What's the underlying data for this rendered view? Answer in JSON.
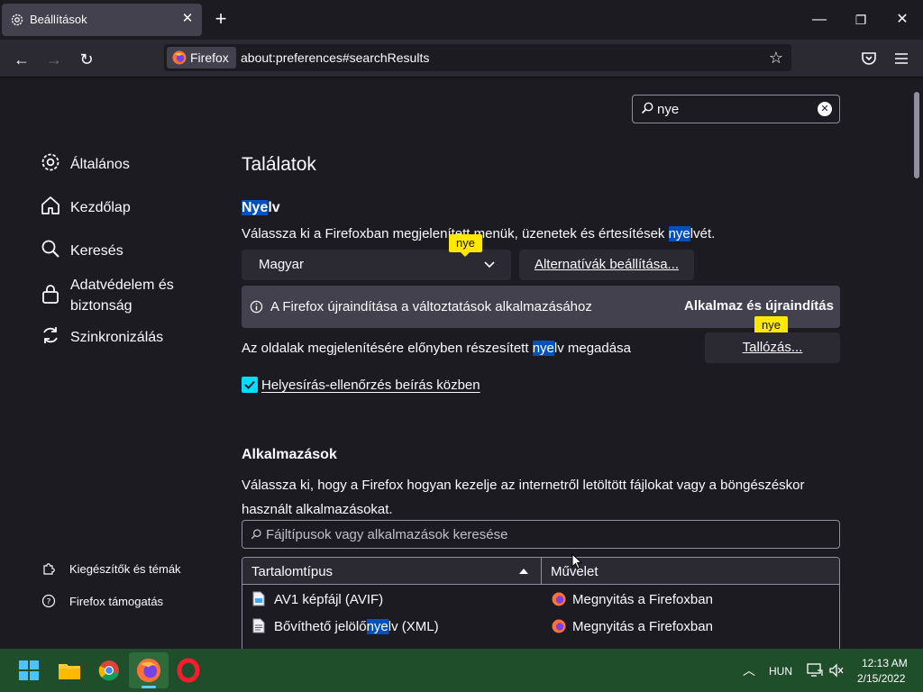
{
  "browser": {
    "tab_title": "Beállítások",
    "identity_label": "Firefox",
    "url": "about:preferences#searchResults"
  },
  "search": {
    "value": "nye"
  },
  "sidebar": {
    "categories": [
      {
        "label": "Általános"
      },
      {
        "label": "Kezdőlap"
      },
      {
        "label": "Keresés"
      },
      {
        "label": "Adatvédelem és biztonság"
      },
      {
        "label": "Szinkronizálás"
      }
    ],
    "footer": [
      {
        "label": "Kiegészítők és témák"
      },
      {
        "label": "Firefox támogatás"
      }
    ]
  },
  "main": {
    "results_title": "Találatok",
    "language": {
      "heading_hl": "Nye",
      "heading_rest": "lv",
      "desc_before": "Válassza ki a Firefoxban megjelenített menük, üzenetek és értesítések ",
      "desc_hl": "nye",
      "desc_after": "lvét.",
      "select_value": "Magyar",
      "alt_button": "Alternatívák beállítása...",
      "restart_notice": "A Firefox újraindítása a változtatások alkalmazásához",
      "restart_button": "Alkalmaz és újraindítás",
      "pref_before": "Az oldalak megjelenítésére előnyben részesített ",
      "pref_hl": "nye",
      "pref_after": "lv megadása",
      "browse_button": "Tallózás...",
      "spellcheck_label": "Helyesírás-ellenőrzés beírás közben",
      "spellcheck_checked": true
    },
    "badges": [
      "nye",
      "nye"
    ],
    "apps": {
      "heading": "Alkalmazások",
      "desc_line1": "Válassza ki, hogy a Firefox hogyan kezelje az internetről letöltött fájlokat vagy a böngészéskor",
      "desc_line2": "használt alkalmazásokat.",
      "filter_placeholder": "Fájltípusok vagy alkalmazások keresése",
      "col_type": "Tartalomtípus",
      "col_action": "Művelet",
      "rows": [
        {
          "type_before": "AV1 képfájl (AVIF)",
          "type_hl": "",
          "type_after": "",
          "action": "Megnyitás a Firefoxban"
        },
        {
          "type_before": "Bővíthető jelölő",
          "type_hl": "nye",
          "type_after": "lv (XML)",
          "action": "Megnyitás a Firefoxban"
        }
      ]
    }
  },
  "taskbar": {
    "language": "HUN",
    "time": "12:13 AM",
    "date": "2/15/2022"
  },
  "colors": {
    "background": "#1c1b22",
    "highlight": "#0250bb",
    "badge": "#ffe900",
    "accent": "#00ddff",
    "taskbar": "#1e4f2a"
  }
}
